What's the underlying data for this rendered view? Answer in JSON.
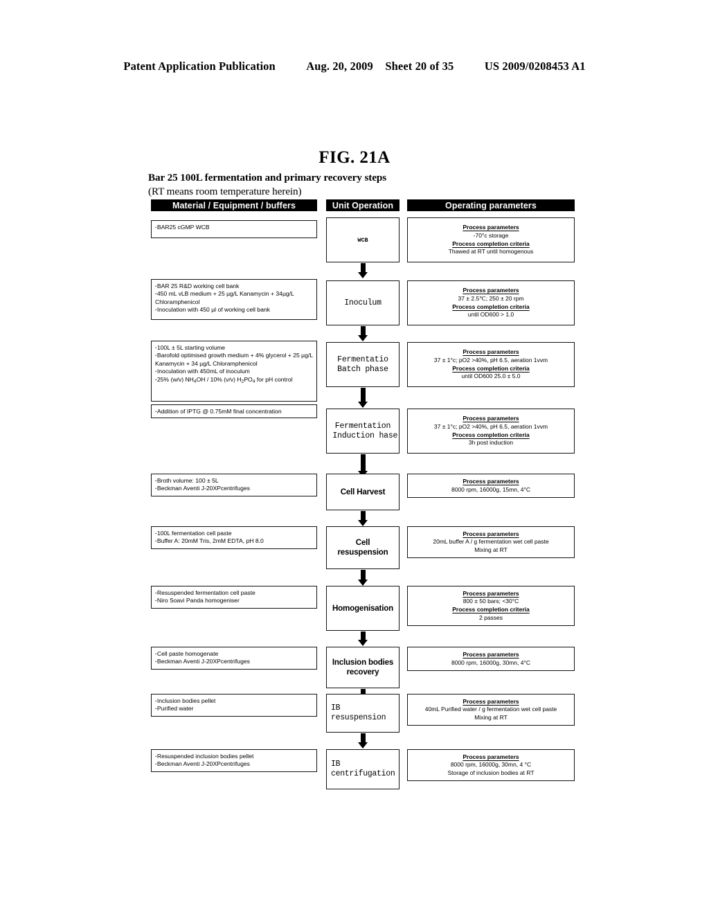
{
  "patent_header": {
    "publication": "Patent Application Publication",
    "date": "Aug. 20, 2009",
    "sheet": "Sheet 20 of 35",
    "number": "US 2009/0208453 A1"
  },
  "figure": {
    "label": "FIG. 21A",
    "subtitle": "Bar 25 100L fermentation and primary recovery steps",
    "note": "(RT means room temperature herein)"
  },
  "columns": {
    "material": "Material / Equipment /  buffers",
    "unit_operation": "Unit Operation",
    "operating_parameters": "Operating parameters"
  },
  "rows": [
    {
      "id": "wcb",
      "material": [
        "BAR25 cGMP WCB"
      ],
      "operation": "WCB",
      "parameters": [
        {
          "type": "header",
          "text": "Process parameters"
        },
        {
          "type": "value",
          "text": "-70°c storage"
        },
        {
          "type": "header",
          "text": "Process completion criteria"
        },
        {
          "type": "value",
          "text": "Thawed at RT until homogenous"
        }
      ]
    },
    {
      "id": "inoculum",
      "material": [
        "BAR 25 R&D working cell bank",
        "450 mL vLB medium + 25 µg/L Kanamycin + 34µg/L Chloramphenicol",
        "Inoculation with 450 µl of working cell bank"
      ],
      "operation": "Inoculum",
      "parameters": [
        {
          "type": "header",
          "text": "Process parameters"
        },
        {
          "type": "value",
          "text": "37 ± 2.5℃; 250 ± 20 rpm"
        },
        {
          "type": "header",
          "text": "Process completion criteria"
        },
        {
          "type": "value",
          "text": "until OD600  > 1.0"
        }
      ]
    },
    {
      "id": "fermentation-batch",
      "material": [
        "100L ± 5L starting volume",
        "Barofold optimised growth medium + 4% glycerol + 25 µg/L Kanamycin + 34 µg/L Chloramphenicol",
        "Inoculation with 450mL of inoculum",
        "25% (w/v) NH4OH / 10% (v/v) H2PO4 for pH control"
      ],
      "operation": "Fermentatio\nBatch phase",
      "parameters": [
        {
          "type": "header",
          "text": "Process parameters"
        },
        {
          "type": "value",
          "text": "37 ± 1°c; pO2 >40%, pH 6.5, aeration 1vvm"
        },
        {
          "type": "header",
          "text": "Process completion criteria"
        },
        {
          "type": "value",
          "text": "until OD600  25.0 ± 5.0"
        }
      ]
    },
    {
      "id": "fermentation-induction",
      "material": [
        "Addition of IPTG @ 0.75mM final concentration"
      ],
      "operation": "Fermentation\n Induction hase",
      "parameters": [
        {
          "type": "header",
          "text": "Process parameters"
        },
        {
          "type": "value",
          "text": "37 ± 1°c; pO2 >40%, pH 6.5, aeration 1vvm"
        },
        {
          "type": "header",
          "text": "Process completion criteria"
        },
        {
          "type": "value",
          "text": "3h post induction"
        }
      ]
    },
    {
      "id": "cell-harvest",
      "material": [
        "Broth volume: 100 ± 5L",
        "Beckman Aventi J-20XPcentrifuges"
      ],
      "operation": "Cell Harvest",
      "parameters": [
        {
          "type": "header",
          "text": "Process parameters"
        },
        {
          "type": "value",
          "text": "8000 rpm, 16000g, 15mn, 4°C"
        }
      ]
    },
    {
      "id": "cell-resuspension",
      "material": [
        "100L fermentation cell paste",
        "Buffer A: 20mM Tris, 2mM EDTA, pH 8.0"
      ],
      "operation": "Cell\nresuspension",
      "parameters": [
        {
          "type": "header",
          "text": "Process parameters"
        },
        {
          "type": "value",
          "text": "20mL buffer A / g fermentation wet cell paste"
        },
        {
          "type": "value",
          "text": "Mixing at RT"
        }
      ]
    },
    {
      "id": "homogenisation",
      "material": [
        "Resuspended fermentation cell paste",
        "Niro Soavi Panda homogeniser"
      ],
      "operation": "Homogenisation",
      "parameters": [
        {
          "type": "header",
          "text": "Process parameters"
        },
        {
          "type": "value",
          "text": "800 ± 50 bars; <30°C"
        },
        {
          "type": "header",
          "text": "Process completion criteria"
        },
        {
          "type": "value",
          "text": "2 passes"
        }
      ]
    },
    {
      "id": "inclusion-bodies-recovery",
      "material": [
        "Cell paste homogenate",
        "Beckman Aventi J-20XPcentrifuges"
      ],
      "operation": "Inclusion bodies\nrecovery",
      "parameters": [
        {
          "type": "header",
          "text": "Process parameters"
        },
        {
          "type": "value",
          "text": "8000 rpm, 16000g, 30mn, 4°C"
        }
      ]
    },
    {
      "id": "ib-resuspension",
      "material": [
        "Inclusion bodies pellet",
        "Purified water"
      ],
      "operation": "IB\nresuspension",
      "parameters": [
        {
          "type": "header",
          "text": "Process parameters"
        },
        {
          "type": "value",
          "text": "40mL Purified water / g fermentation wet cell paste"
        },
        {
          "type": "value",
          "text": "Mixing at RT"
        }
      ]
    },
    {
      "id": "ib-centrifugation",
      "material": [
        "Resuspended inclusion bodies pellet",
        "Beckman Aventi J-20XPcentrifuges"
      ],
      "operation": "IB\ncentrifugation",
      "parameters": [
        {
          "type": "header",
          "text": "Process parameters"
        },
        {
          "type": "value",
          "text": "8000 rpm, 16000g, 30mn, 4 °C"
        },
        {
          "type": "value",
          "text": "Storage of inclusion bodies at RT"
        }
      ]
    }
  ]
}
